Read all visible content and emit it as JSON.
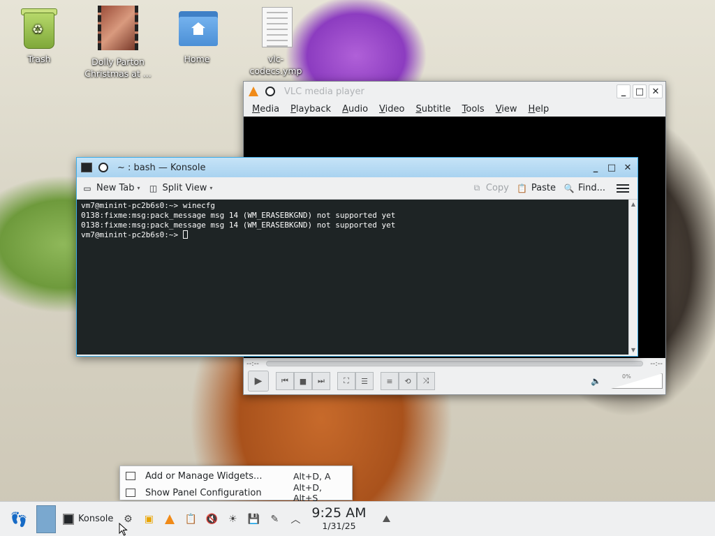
{
  "desktop": {
    "icons": [
      {
        "label": "Trash"
      },
      {
        "label": "Dolly Parton Christmas at ..."
      },
      {
        "label": "Home"
      },
      {
        "label": "vlc-codecs.ymp"
      }
    ]
  },
  "vlc": {
    "title": "VLC media player",
    "menu": [
      "Media",
      "Playback",
      "Audio",
      "Video",
      "Subtitle",
      "Tools",
      "View",
      "Help"
    ],
    "time_elapsed": "--:--",
    "time_total": "--:--",
    "volume_percent": "0%",
    "buttons": {
      "minimize": "_",
      "maximize": "□",
      "close": "✕"
    }
  },
  "konsole": {
    "title": "~ : bash — Konsole",
    "toolbar": {
      "new_tab": "New Tab",
      "split_view": "Split View",
      "copy": "Copy",
      "paste": "Paste",
      "find": "Find..."
    },
    "lines": [
      "vm7@minint-pc2b6s0:~> winecfg",
      "0138:fixme:msg:pack_message msg 14 (WM_ERASEBKGND) not supported yet",
      "0138:fixme:msg:pack_message msg 14 (WM_ERASEBKGND) not supported yet"
    ],
    "prompt": "vm7@minint-pc2b6s0:~> "
  },
  "context_menu": {
    "items": [
      {
        "label": "Add or Manage Widgets...",
        "shortcut": "Alt+D, A"
      },
      {
        "label": "Show Panel Configuration",
        "shortcut": "Alt+D, Alt+S"
      }
    ]
  },
  "taskbar": {
    "task_label": "Konsole",
    "time": "9:25 AM",
    "date": "1/31/25"
  },
  "colors": {
    "konsole_titlebar": "#a9d3f0",
    "terminal_bg": "#1e2425",
    "vlc_accent": "#f08a18",
    "panel_bg": "#eff0f1"
  }
}
